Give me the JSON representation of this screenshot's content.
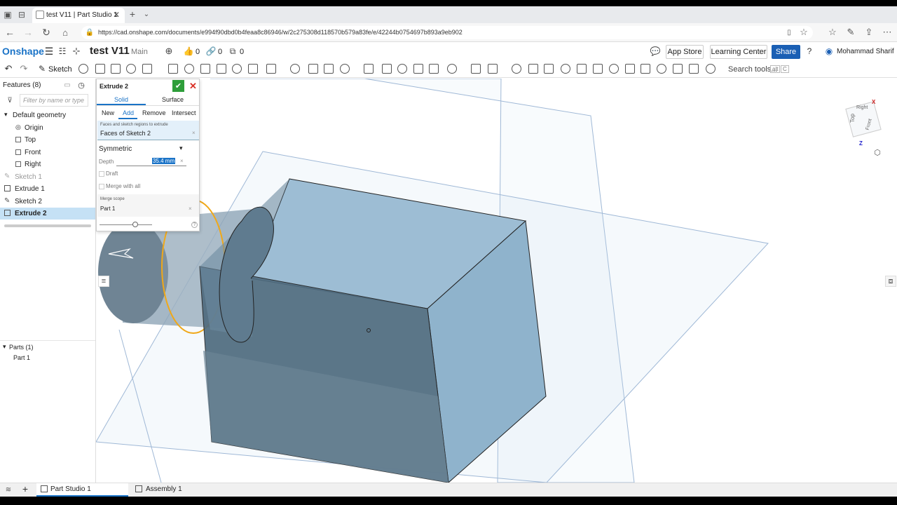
{
  "browser": {
    "tab_title": "test V11 | Part Studio 1",
    "url": "https://cad.onshape.com/documents/e994f90dbd0b4feaa8c86946/w/2c275308d118570b579a83fe/e/42244b0754697b893a9eb902"
  },
  "app": {
    "brand": "Onshape",
    "doc_title": "test V11",
    "branch": "Main",
    "likes": "0",
    "links": "0",
    "copies": "0",
    "app_store": "App Store",
    "learning_center": "Learning Center",
    "share": "Share",
    "user": "Mohammad Sharif"
  },
  "toolbar": {
    "sketch": "Sketch",
    "search_tools": "Search tools...",
    "shortcut_alt": "alt",
    "shortcut_c": "C"
  },
  "features": {
    "header": "Features (8)",
    "filter_placeholder": "Filter by name or type",
    "default_geometry": "Default geometry",
    "items": [
      "Origin",
      "Top",
      "Front",
      "Right"
    ],
    "sketch1": "Sketch 1",
    "extrude1": "Extrude 1",
    "sketch2": "Sketch 2",
    "extrude2": "Extrude 2",
    "parts_header": "Parts (1)",
    "part1": "Part 1"
  },
  "dialog": {
    "title": "Extrude 2",
    "tab_solid": "Solid",
    "tab_surface": "Surface",
    "op_new": "New",
    "op_add": "Add",
    "op_remove": "Remove",
    "op_intersect": "Intersect",
    "faces_label": "Faces and sketch regions to extrude",
    "faces_value": "Faces of Sketch 2",
    "end_type": "Symmetric",
    "depth_label": "Depth",
    "depth_value": "35.4 mm",
    "draft": "Draft",
    "merge_all": "Merge with all",
    "merge_scope_label": "Merge scope",
    "merge_scope_value": "Part 1"
  },
  "viewcube": {
    "top": "Top",
    "front": "Front",
    "right": "Right",
    "axis_x": "X",
    "axis_z": "Z"
  },
  "bottom_tabs": {
    "part_studio": "Part Studio 1",
    "assembly": "Assembly 1"
  },
  "colors": {
    "brand": "#1a73c7",
    "share_bg": "#1a5fb4",
    "selection": "#c5e1f5",
    "confirm": "#2e9e3a",
    "cancel": "#d93025",
    "body_face_dark": "#4f6b7f",
    "body_face_light": "#8fb3cc",
    "highlight": "#f0a818"
  }
}
